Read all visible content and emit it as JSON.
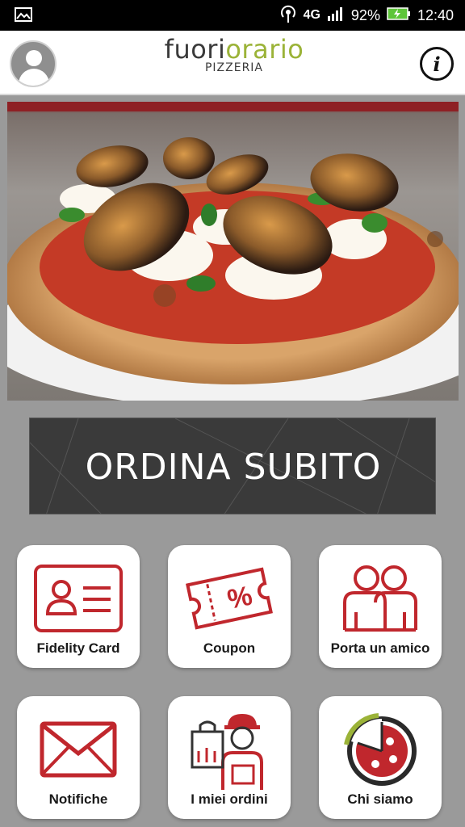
{
  "status_bar": {
    "network": "4G",
    "battery": "92%",
    "time": "12:40"
  },
  "header": {
    "logo_part1": "fuori",
    "logo_part2": "orario",
    "logo_sub": "PIZZERIA",
    "info_label": "i"
  },
  "order_button": {
    "label": "ORDINA SUBITO"
  },
  "tiles": [
    {
      "label": "Fidelity Card",
      "icon": "id-card-icon"
    },
    {
      "label": "Coupon",
      "icon": "coupon-icon"
    },
    {
      "label": "Porta un amico",
      "icon": "friends-icon"
    },
    {
      "label": "Notifiche",
      "icon": "envelope-icon"
    },
    {
      "label": "I miei ordini",
      "icon": "delivery-man-icon"
    },
    {
      "label": "Chi siamo",
      "icon": "pizza-clock-icon"
    }
  ],
  "colors": {
    "accent_red": "#c0272d",
    "brand_green": "#9bb338",
    "order_bg": "#3a3a3a"
  }
}
